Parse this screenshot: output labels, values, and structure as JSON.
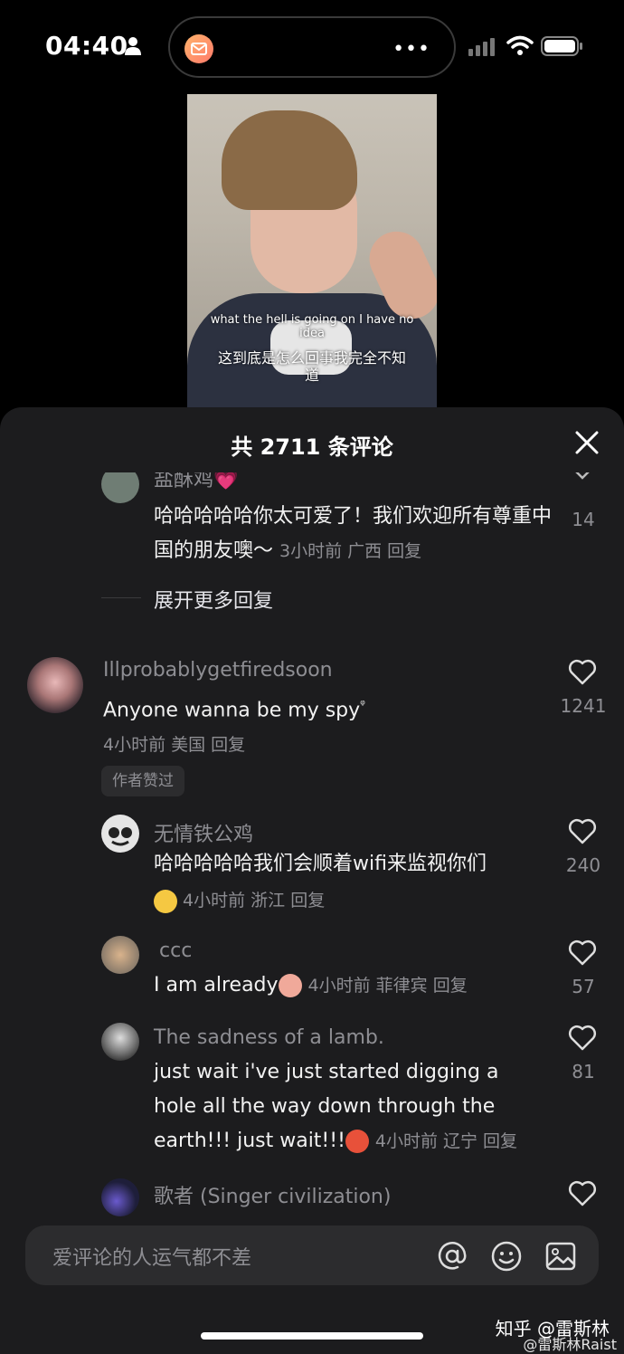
{
  "status_bar": {
    "time": "04:40"
  },
  "video": {
    "subtitle_en": "what the hell is going on I have no idea",
    "subtitle_zh": "这到底是怎么回事我完全不知道"
  },
  "sheet": {
    "title": "共 2711 条评论"
  },
  "comments": [
    {
      "name": "盐酥鸡💗",
      "text": "哈哈哈哈哈你太可爱了！我们欢迎所有尊重中国的朋友噢～",
      "meta": "3小时前 广西 回复",
      "likes": "14"
    },
    {
      "expand": "展开更多回复"
    },
    {
      "name": "Illprobablygetfiredsoon",
      "text": "Anyone wanna be my  spy",
      "meta": "4小时前 美国 回复",
      "likes": "1241",
      "badge": "作者赞过"
    },
    {
      "name": "无情铁公鸡",
      "text": "哈哈哈哈哈我们会顺着wifi来监视你们",
      "meta": "4小时前 浙江 回复",
      "likes": "240"
    },
    {
      "name": "ccc",
      "text": "I am already",
      "meta": "4小时前 菲律宾 回复",
      "likes": "57"
    },
    {
      "name": "The sadness of a lamb.",
      "text_line1": "just wait i've just started digging a",
      "text_line2": "hole all the way down through the",
      "text_line3": "earth!!! just wait!!!",
      "meta": "4小时前 辽宁 回复",
      "likes": "81"
    },
    {
      "name": "歌者 (Singer civilization)"
    }
  ],
  "input": {
    "placeholder": "爱评论的人运气都不差"
  },
  "watermark": {
    "line1": "知乎 @雷斯林",
    "line2": "@雷斯林Raist"
  }
}
